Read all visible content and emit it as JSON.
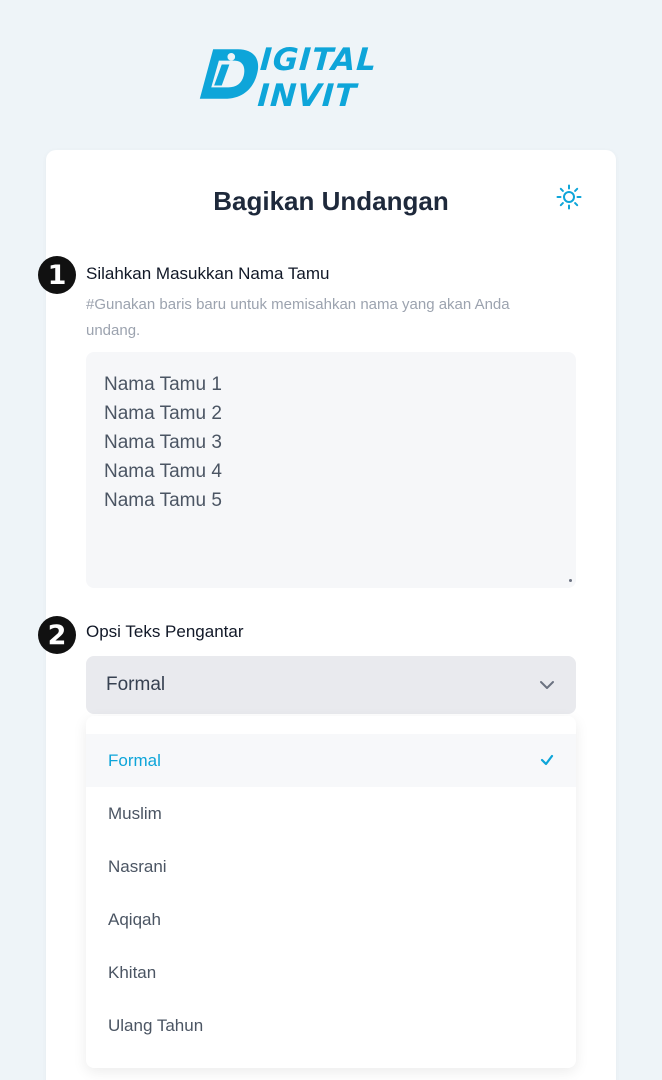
{
  "brand": {
    "logo_text": "IGITAL INVIT",
    "accent": "#0ea5d9"
  },
  "card": {
    "title": "Bagikan Undangan",
    "theme_icon": "sun-icon"
  },
  "step1": {
    "number": "1",
    "label": "Silahkan Masukkan Nama Tamu",
    "hint": "#Gunakan baris baru untuk memisahkan nama yang akan Anda undang.",
    "guests": [
      "Nama Tamu 1",
      "Nama Tamu 2",
      "Nama Tamu 3",
      "Nama Tamu 4",
      "Nama Tamu 5"
    ]
  },
  "step2": {
    "number": "2",
    "label": "Opsi Teks Pengantar",
    "selected": "Formal",
    "options": [
      "Formal",
      "Muslim",
      "Nasrani",
      "Aqiqah",
      "Khitan",
      "Ulang Tahun"
    ]
  }
}
